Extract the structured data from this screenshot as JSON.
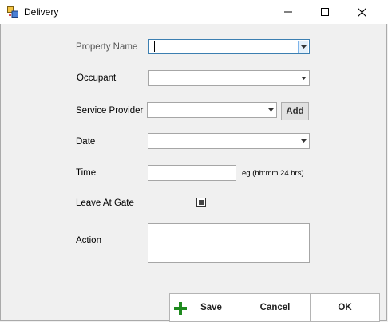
{
  "window": {
    "title": "Delivery",
    "icons": {
      "app": "form-icon",
      "minimize": "minimize-icon",
      "maximize": "maximize-icon",
      "close": "close-icon"
    }
  },
  "form": {
    "property_name": {
      "label": "Property Name",
      "value": ""
    },
    "occupant": {
      "label": "Occupant",
      "value": ""
    },
    "service_provider": {
      "label": "Service Provider",
      "value": "",
      "add_label": "Add"
    },
    "date": {
      "label": "Date",
      "value": ""
    },
    "time": {
      "label": "Time",
      "value": "",
      "hint": "eg.(hh:mm 24 hrs)"
    },
    "leave_at_gate": {
      "label": "Leave At Gate",
      "checked": "indeterminate"
    },
    "action": {
      "label": "Action",
      "value": ""
    }
  },
  "footer": {
    "save_label": "Save",
    "save_icon": "plus-icon",
    "cancel_label": "Cancel",
    "ok_label": "OK"
  },
  "colors": {
    "plus_icon": "#1f8a1f",
    "focus_border": "#3c7fb1"
  }
}
